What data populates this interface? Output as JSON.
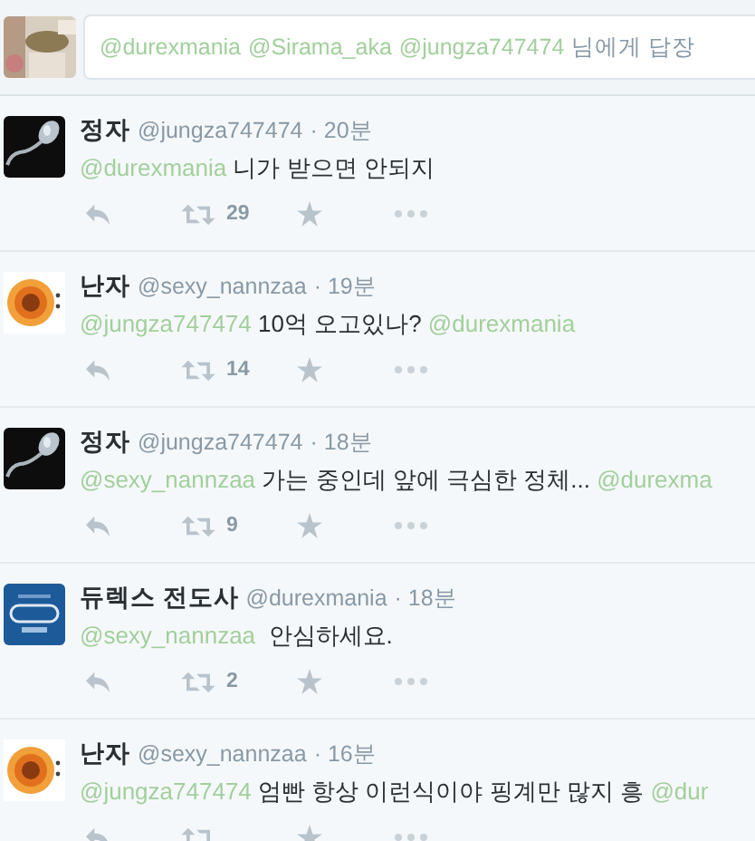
{
  "reply_box": {
    "placeholder_parts": [
      {
        "kind": "mention",
        "text": "@durexmania"
      },
      {
        "kind": "mention",
        "text": "@Sirama_aka"
      },
      {
        "kind": "mention",
        "text": "@jungza747474"
      },
      {
        "kind": "text",
        "text": "님에게 답장"
      }
    ]
  },
  "tweets": [
    {
      "avatar": {
        "kind": "sperm"
      },
      "name": "정자",
      "handle": "@jungza747474",
      "time": "· 20분",
      "body": [
        {
          "kind": "mention",
          "text": "@durexmania"
        },
        {
          "kind": "text",
          "text": " 니가 받으면 안되지"
        }
      ],
      "retweets": "29"
    },
    {
      "avatar": {
        "kind": "flower"
      },
      "name": "난자",
      "handle": "@sexy_nannzaa",
      "time": "· 19분",
      "body": [
        {
          "kind": "mention",
          "text": "@jungza747474"
        },
        {
          "kind": "text",
          "text": " 10억 오고있나? "
        },
        {
          "kind": "mention",
          "text": "@durexmania"
        }
      ],
      "retweets": "14"
    },
    {
      "avatar": {
        "kind": "sperm"
      },
      "name": "정자",
      "handle": "@jungza747474",
      "time": "· 18분",
      "body": [
        {
          "kind": "mention",
          "text": "@sexy_nannzaa"
        },
        {
          "kind": "text",
          "text": " 가는 중인데 앞에 극심한 정체... "
        },
        {
          "kind": "mention",
          "text": "@durexma"
        }
      ],
      "retweets": "9"
    },
    {
      "avatar": {
        "kind": "badge"
      },
      "name": "듀렉스 전도사",
      "handle": "@durexmania",
      "time": "· 18분",
      "body": [
        {
          "kind": "mention",
          "text": "@sexy_nannzaa"
        },
        {
          "kind": "text",
          "text": "  안심하세요."
        }
      ],
      "retweets": "2"
    },
    {
      "avatar": {
        "kind": "flower"
      },
      "name": "난자",
      "handle": "@sexy_nannzaa",
      "time": "· 16분",
      "body": [
        {
          "kind": "mention",
          "text": "@jungza747474"
        },
        {
          "kind": "text",
          "text": " 엄빤 항상 이런식이야 핑계만 많지 흥 "
        },
        {
          "kind": "mention",
          "text": "@dur"
        }
      ]
    }
  ]
}
